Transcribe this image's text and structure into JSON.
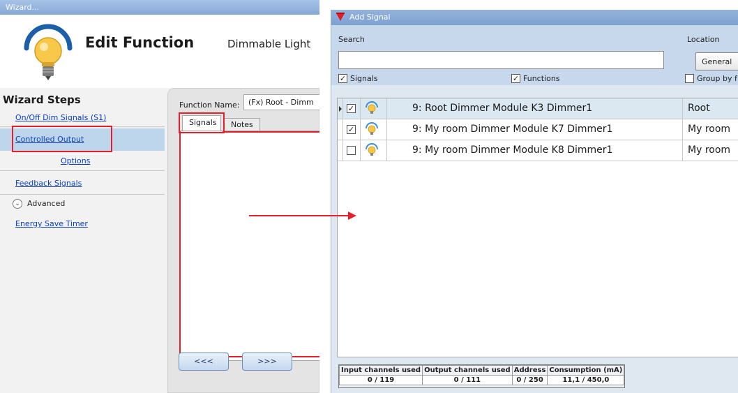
{
  "wizard": {
    "window_title": "Wizard...",
    "heading": "Edit Function",
    "subheading": "Dimmable Light",
    "steps_title": "Wizard Steps",
    "steps": [
      {
        "label": "On/Off Dim Signals (S1)"
      },
      {
        "label": "Controlled Output"
      },
      {
        "label": "Options"
      },
      {
        "label": "Feedback Signals"
      },
      {
        "label": "Energy Save Timer"
      }
    ],
    "advanced_label": "Advanced",
    "function_name_label": "Function Name:",
    "function_name_value": "(Fx) Root - Dimm",
    "tabs": [
      {
        "label": "Signals"
      },
      {
        "label": "Notes"
      }
    ],
    "prev_label": "<<<",
    "next_label": ">>>"
  },
  "add_signal": {
    "window_title": "Add Signal",
    "search_label": "Search",
    "search_value": "",
    "location_label": "Location",
    "location_value": "General",
    "filters": {
      "signals": {
        "label": "Signals",
        "checked": true
      },
      "functions": {
        "label": "Functions",
        "checked": true
      },
      "group_by": {
        "label": "Group by f",
        "checked": false
      }
    },
    "rows": [
      {
        "name": "9: Root Dimmer Module K3 Dimmer1",
        "location": "Root",
        "checked": true,
        "selected": true
      },
      {
        "name": "9: My room Dimmer Module K7 Dimmer1",
        "location": "My room",
        "checked": true,
        "selected": false
      },
      {
        "name": "9: My room Dimmer Module K8 Dimmer1",
        "location": "My room",
        "checked": false,
        "selected": false
      }
    ],
    "stats": {
      "headers": [
        "Input channels used",
        "Output channels used",
        "Address",
        "Consumption (mA)"
      ],
      "values": [
        "0 / 119",
        "0 / 111",
        "0 / 250",
        "11,1 / 450,0"
      ]
    }
  },
  "icons": {
    "lightbulb": "lightbulb-icon",
    "add_signal_logo": "red-triangle-logo-icon",
    "advanced": "chevron-down-icon"
  },
  "colors": {
    "highlight": "#e6202a",
    "link": "#0b3fbf",
    "selected_step": "#bdd6ec",
    "selected_row": "#dbe8f1"
  }
}
